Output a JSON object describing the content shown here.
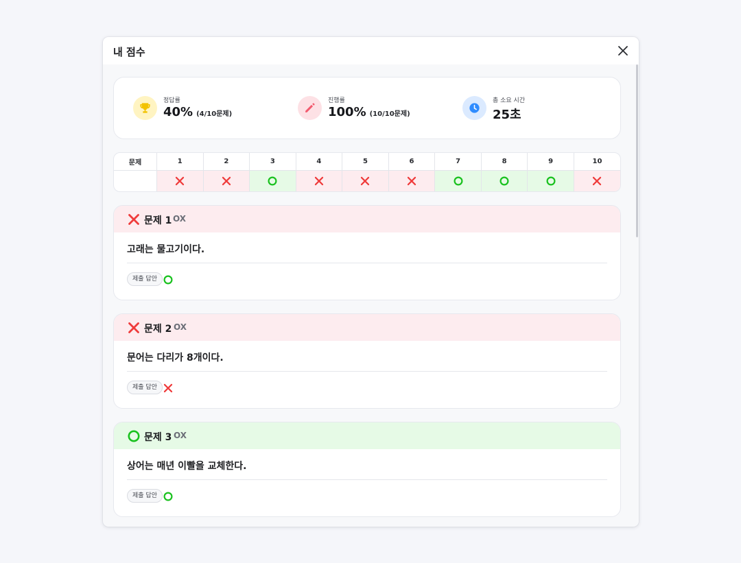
{
  "modal": {
    "title": "내 점수",
    "close_icon": "close-icon"
  },
  "summary": {
    "accuracy": {
      "label": "정답률",
      "value": "40%",
      "detail": "(4/10문제)",
      "icon": "trophy-icon",
      "icon_color": "#f2c200",
      "icon_bg": "#fff4c2"
    },
    "progress": {
      "label": "진행률",
      "value": "100%",
      "detail": "(10/10문제)",
      "icon": "pencil-icon",
      "icon_color": "#f25a6e",
      "icon_bg": "#fde1e5"
    },
    "time": {
      "label": "총 소요 시간",
      "value": "25초",
      "icon": "clock-icon",
      "icon_color": "#2f8cff",
      "icon_bg": "#dbeaff"
    }
  },
  "grid": {
    "header_label": "문제",
    "numbers": [
      "1",
      "2",
      "3",
      "4",
      "5",
      "6",
      "7",
      "8",
      "9",
      "10"
    ],
    "results": [
      "X",
      "X",
      "O",
      "X",
      "X",
      "X",
      "O",
      "O",
      "O",
      "X"
    ]
  },
  "questions": [
    {
      "title": "문제 1",
      "type": "OX",
      "correct": false,
      "text": "고래는 물고기이다.",
      "submitted_label": "제출 답안",
      "submitted": "O"
    },
    {
      "title": "문제 2",
      "type": "OX",
      "correct": false,
      "text": "문어는 다리가 8개이다.",
      "submitted_label": "제출 답안",
      "submitted": "X"
    },
    {
      "title": "문제 3",
      "type": "OX",
      "correct": true,
      "text": "상어는 매년 이빨을 교체한다.",
      "submitted_label": "제출 답안",
      "submitted": "O"
    }
  ],
  "colors": {
    "wrong": "#ef3b3b",
    "correct": "#19c11e",
    "wrong_bg": "#fdecef",
    "correct_bg": "#e6fae6"
  }
}
